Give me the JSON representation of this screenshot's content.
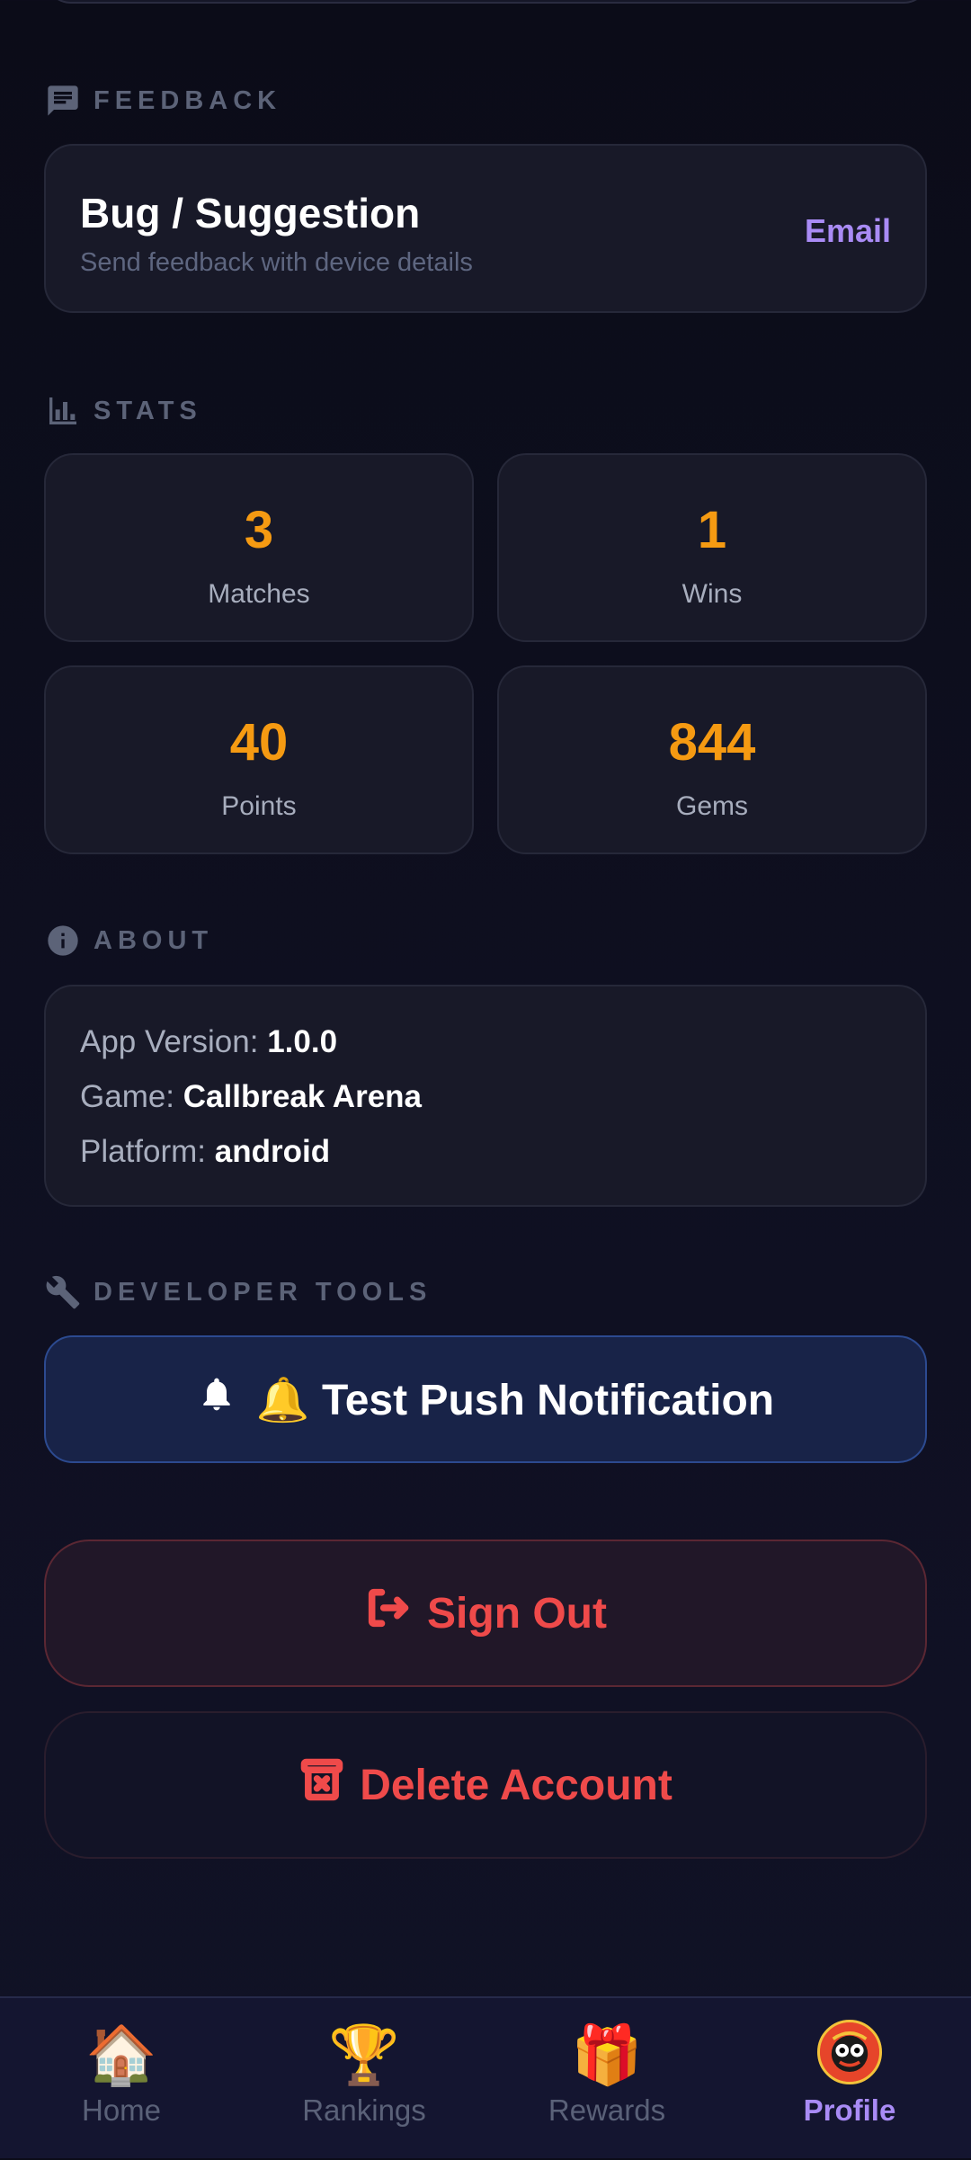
{
  "feedback": {
    "section_title": "FEEDBACK",
    "title": "Bug / Suggestion",
    "subtitle": "Send feedback with device details",
    "action_label": "Email",
    "icon": "feedback-icon"
  },
  "stats": {
    "section_title": "STATS",
    "icon": "bar-chart-icon",
    "items": [
      {
        "value": "3",
        "label": "Matches"
      },
      {
        "value": "1",
        "label": "Wins"
      },
      {
        "value": "40",
        "label": "Points"
      },
      {
        "value": "844",
        "label": "Gems"
      }
    ]
  },
  "about": {
    "section_title": "ABOUT",
    "icon": "info-icon",
    "app_version_label": "App Version:",
    "app_version": "1.0.0",
    "game_label": "Game:",
    "game": "Callbreak Arena",
    "platform_label": "Platform:",
    "platform": "android"
  },
  "developer": {
    "section_title": "DEVELOPER TOOLS",
    "icon": "wrench-icon",
    "test_push_label": "🔔 Test Push Notification"
  },
  "account": {
    "sign_out_label": "Sign Out",
    "delete_label": "Delete Account"
  },
  "nav": {
    "items": [
      {
        "label": "Home",
        "icon": "🏠"
      },
      {
        "label": "Rankings",
        "icon": "🏆"
      },
      {
        "label": "Rewards",
        "icon": "🎁"
      },
      {
        "label": "Profile",
        "icon": "avatar"
      }
    ],
    "active": "Profile"
  },
  "colors": {
    "accent": "#a98bf5",
    "stat_value": "#f59a12",
    "danger": "#ef4a4a",
    "background": "#0f1022"
  }
}
